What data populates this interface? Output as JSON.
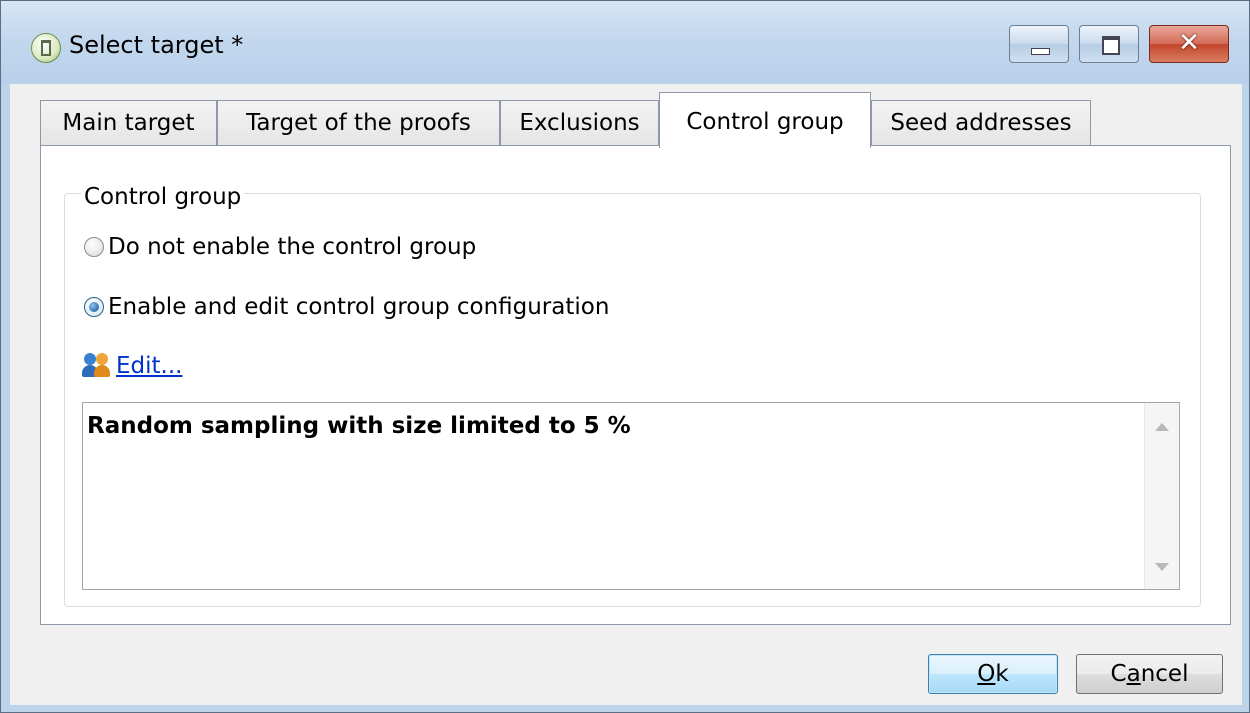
{
  "window": {
    "title": "Select target *"
  },
  "tabs": [
    {
      "label": "Main target",
      "active": false
    },
    {
      "label": "Target of the proofs",
      "active": false
    },
    {
      "label": "Exclusions",
      "active": false
    },
    {
      "label": "Control group",
      "active": true
    },
    {
      "label": "Seed addresses",
      "active": false
    }
  ],
  "control_group": {
    "legend": "Control group",
    "options": [
      {
        "label": "Do not enable the control group",
        "checked": false
      },
      {
        "label": "Enable and edit control group configuration",
        "checked": true
      }
    ],
    "edit_link": "Edit...",
    "summary": "Random sampling with size limited to 5 %"
  },
  "buttons": {
    "ok_prefix": "O",
    "ok_rest": "k",
    "cancel_prefix": "C",
    "cancel_mid": "a",
    "cancel_rest": "ncel"
  },
  "icons": {
    "app": "app-icon",
    "people": "people-icon"
  }
}
